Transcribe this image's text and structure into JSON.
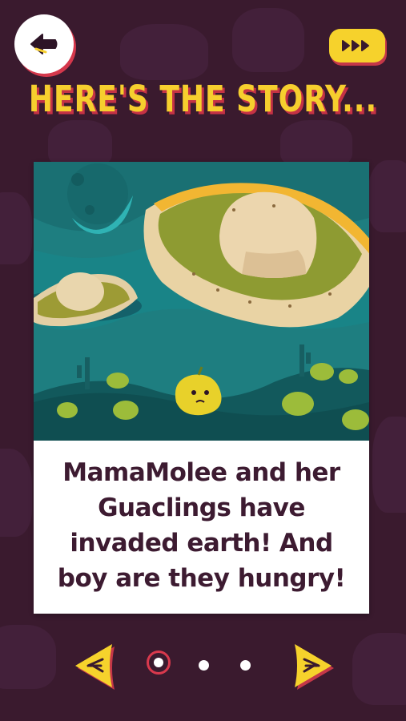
{
  "header": {
    "back_icon": "back-arrow-icon",
    "skip_icon": "fast-forward-icon",
    "title": "HERE'S THE STORY..."
  },
  "story": {
    "text": "MamaMolee and her Guaclings have invaded earth! And boy are they hungry!",
    "current_page": 1,
    "total_pages": 3
  },
  "pagination": {
    "prev_icon": "prev-arrow-icon",
    "next_icon": "next-arrow-icon"
  },
  "colors": {
    "background": "#3a1a2e",
    "title_yellow": "#f6cf2e",
    "title_shadow": "#c53245",
    "teal": "#1f8c8a",
    "text": "#3d1b31"
  }
}
